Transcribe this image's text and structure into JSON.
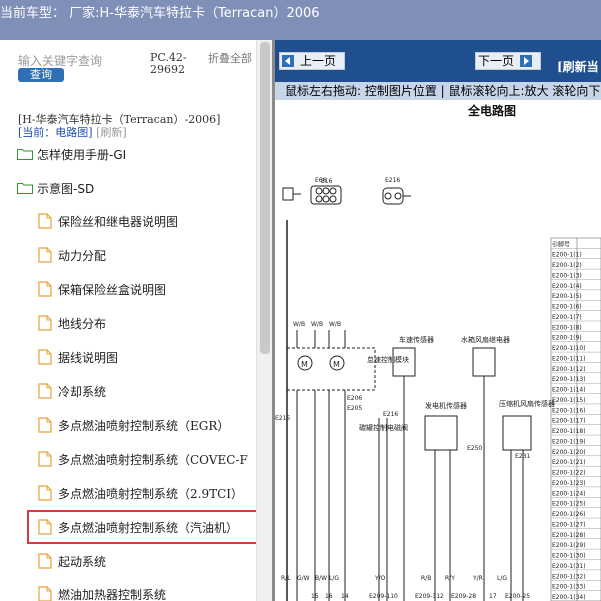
{
  "header": {
    "text": "当前车型： 厂家:H-华泰汽车特拉卡（Terracan）2006"
  },
  "sidebar": {
    "search_placeholder": "输入关键字查询",
    "search_button": "查询",
    "pc_code": "PC.42-29692",
    "collapse_all": "折叠全部",
    "vehicle_title": "[H-华泰汽车特拉卡（Terracan）-2006]",
    "current_label": "[当前：电路图]",
    "refresh_label": "[刷新]",
    "folders": [
      {
        "label": "怎样使用手册-GI"
      },
      {
        "label": "示意图-SD"
      }
    ],
    "items": [
      {
        "label": "保险丝和继电器说明图"
      },
      {
        "label": "动力分配"
      },
      {
        "label": "保箱保险丝盒说明图"
      },
      {
        "label": "地线分布"
      },
      {
        "label": "据线说明图"
      },
      {
        "label": "冷却系统"
      },
      {
        "label": "多点燃油喷射控制系统（EGR）"
      },
      {
        "label": "多点燃油喷射控制系统（COVEC-F"
      },
      {
        "label": "多点燃油喷射控制系统（2.9TCI）"
      },
      {
        "label": "多点燃油喷射控制系统（汽油机）"
      },
      {
        "label": "起动系统"
      },
      {
        "label": "燃油加热器控制系统"
      }
    ]
  },
  "viewer": {
    "prev_page": "上一页",
    "next_page": "下一页",
    "refresh": "[刷新当",
    "hint": "鼠标左右拖动: 控制图片位置 | 鼠标滚轮向上:放大  滚轮向下",
    "diagram_title": "全电路图",
    "connector_labels": [
      "E66",
      "E16",
      "E216",
      "E206",
      "E215",
      "E205",
      "E216",
      "E250",
      "E231"
    ],
    "component_labels": [
      "怠速控制模块",
      "车速传感器",
      "水箱风扇继电器",
      "发电机传感器",
      "压缩机风扇传感器",
      "碳罐控制电磁阀"
    ],
    "wire_labels": [
      "W/B",
      "W/B",
      "W/B",
      "R/L",
      "G/W",
      "B/W",
      "L/G",
      "Y/O",
      "R/B",
      "R/Y",
      "Y/R",
      "L/G"
    ],
    "pin_numbers": [
      "15",
      "16",
      "14",
      "E209-110",
      "E209-312",
      "E209-28",
      "17",
      "E200-25"
    ],
    "table_rows": [
      "引脚号",
      "E200-1(1)",
      "E200-1(2)",
      "E200-1(3)",
      "E200-1(4)",
      "E200-1(5)",
      "E200-1(6)",
      "E200-1(7)",
      "E200-1(8)",
      "E200-1(9)",
      "E200-1(10)",
      "E200-1(11)",
      "E200-1(12)",
      "E200-1(13)",
      "E200-1(14)",
      "E200-1(15)",
      "E200-1(16)",
      "E200-1(17)",
      "E200-1(18)",
      "E200-1(19)",
      "E200-1(20)",
      "E200-1(21)",
      "E200-1(22)",
      "E200-1(23)",
      "E200-1(24)",
      "E200-1(25)",
      "E200-1(26)",
      "E200-1(27)",
      "E200-1(28)",
      "E200-1(29)",
      "E200-1(30)",
      "E200-1(31)",
      "E200-1(32)",
      "E200-1(33)",
      "E200-1(34)"
    ]
  },
  "colors": {
    "header_bg": "#7f8fb8",
    "nav_bg": "#1f4f8e",
    "hint_bg": "#c7d5e8",
    "search_btn": "#2f6fb3",
    "highlight": "#d9393b"
  }
}
